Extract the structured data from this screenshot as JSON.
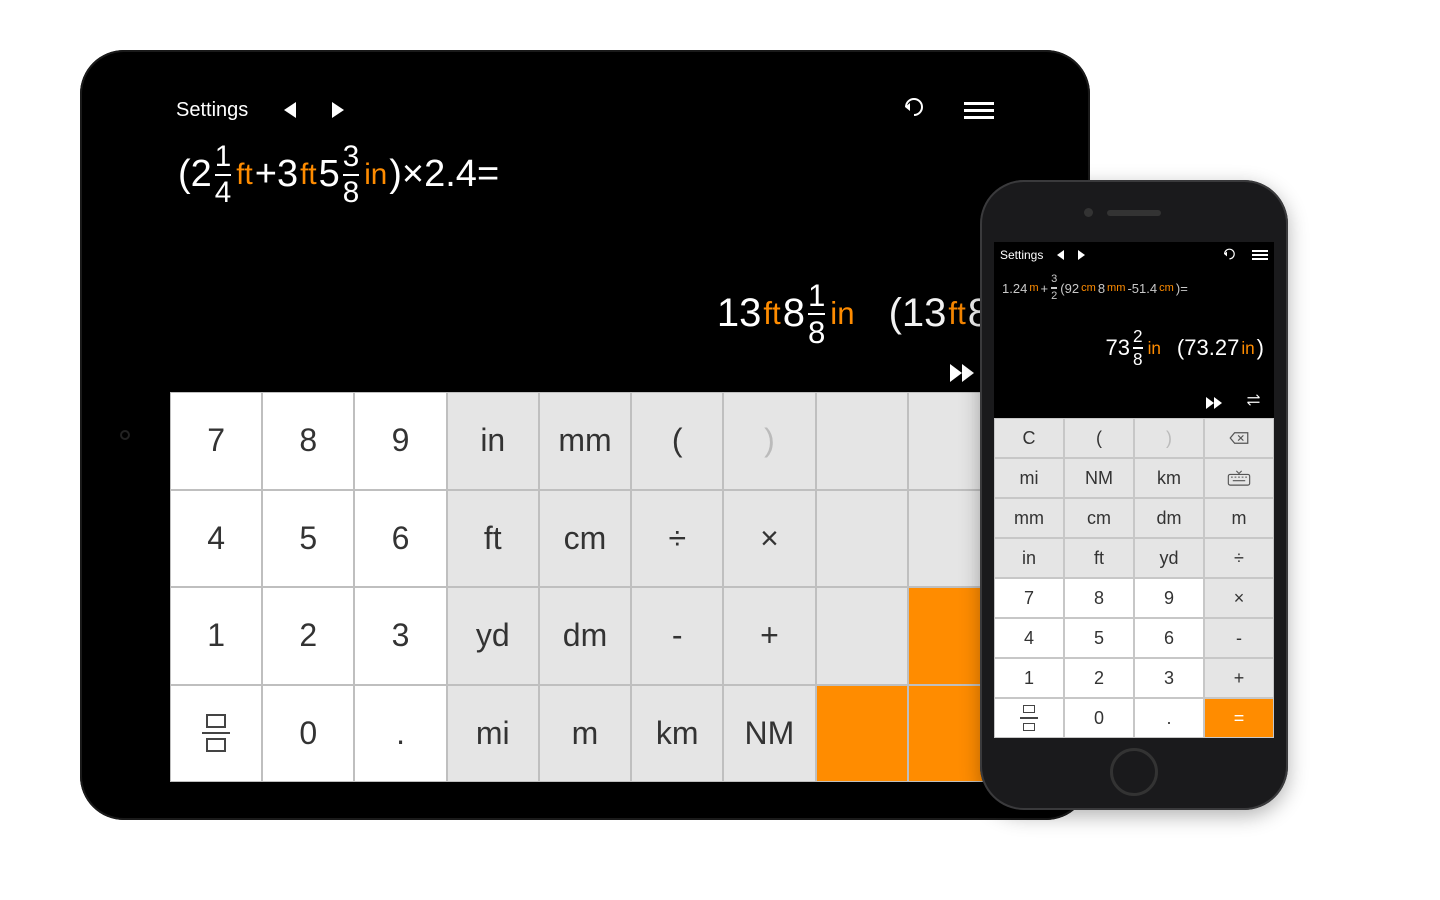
{
  "ipad": {
    "topbar": {
      "settings": "Settings"
    },
    "expr": {
      "open": "(",
      "whole1": "2",
      "f1n": "1",
      "f1d": "4",
      "u1": "ft",
      "plus": " + ",
      "whole2": "3",
      "u2": "ft",
      "whole3": "5",
      "f2n": "3",
      "f2d": "8",
      "u3": "in",
      "close": ")",
      "times": " × ",
      "factor": "2.4",
      "eq": " ="
    },
    "result": {
      "ftval": "13",
      "ftu": "ft",
      "inwhole": " 8",
      "rn": "1",
      "rd": "8",
      "inu": "in",
      "alt_open": "(",
      "alt_val": "13",
      "alt_u": "ft",
      "alt_rest": " 8"
    },
    "keys": {
      "r": [
        [
          "7",
          "8",
          "9",
          "in",
          "mm",
          "(",
          ")",
          "",
          ""
        ],
        [
          "4",
          "5",
          "6",
          "ft",
          "cm",
          "÷",
          "×",
          "",
          ""
        ],
        [
          "1",
          "2",
          "3",
          "yd",
          "dm",
          "-",
          "+",
          "",
          ""
        ],
        [
          "frac",
          "0",
          ".",
          "mi",
          "m",
          "km",
          "NM",
          "",
          ""
        ]
      ]
    }
  },
  "iphone": {
    "topbar": {
      "settings": "Settings"
    },
    "expr": {
      "a": "1.24",
      "au": "m",
      "plus": " + ",
      "fn": "3",
      "fd": "2",
      "open": "(",
      "b": "92",
      "bu": "cm",
      "c": "8",
      "cu": "mm",
      "minus": " - ",
      "d": "51.4",
      "du": "cm",
      "close": ")",
      "eq": " ="
    },
    "result": {
      "whole": "73",
      "rn": "2",
      "rd": "8",
      "u": "in",
      "alt_open": "(",
      "alt_val": "73.27",
      "alt_u": "in",
      "alt_close": ")"
    },
    "keys": {
      "r": [
        [
          "C",
          "(",
          ")",
          "bksp"
        ],
        [
          "mi",
          "NM",
          "km",
          "kbd"
        ],
        [
          "mm",
          "cm",
          "dm",
          "m"
        ],
        [
          "in",
          "ft",
          "yd",
          "÷"
        ],
        [
          "7",
          "8",
          "9",
          "×"
        ],
        [
          "4",
          "5",
          "6",
          "-"
        ],
        [
          "1",
          "2",
          "3",
          "+"
        ],
        [
          "frac",
          "0",
          ".",
          "="
        ]
      ]
    }
  }
}
